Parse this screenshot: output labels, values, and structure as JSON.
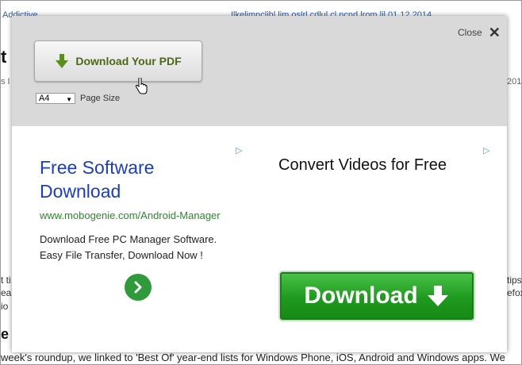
{
  "background": {
    "top_left_link": "Addictive",
    "top_right_link": "Ilkeljmnclihl lim oslrl cdlul cl ncnd lrom lil 01 12 2014",
    "heading_fragment": "t",
    "meta_left": "s I",
    "meta_right": "2014",
    "left_lines": [
      "t ti",
      "ea",
      "io"
    ],
    "right_lines": [
      "tips",
      "efox"
    ],
    "section_fragment": "e 2",
    "body_text": "week's roundup, we linked to 'Best Of' year-end lists for Windows Phone, iOS, Android and Windows apps. We"
  },
  "modal": {
    "download_pdf_label": "Download Your PDF",
    "page_size_value": "A4",
    "page_size_label": "Page Size",
    "close_label": "Close",
    "close_icon": "✕"
  },
  "ad_left": {
    "title": "Free Software Download",
    "url": "www.mobogenie.com/Android-Manager",
    "description": "Download Free PC Manager Software. Easy File Transfer, Download Now !",
    "adchoices": "▷"
  },
  "ad_right": {
    "title": "Convert Videos for Free",
    "button_label": "Download",
    "adchoices": "▷"
  },
  "colors": {
    "modal_header": "#d9d9d9",
    "ad_title": "#1a3ccc",
    "ad_url": "#2a8a2a",
    "download_green": "#1f9a1f"
  }
}
